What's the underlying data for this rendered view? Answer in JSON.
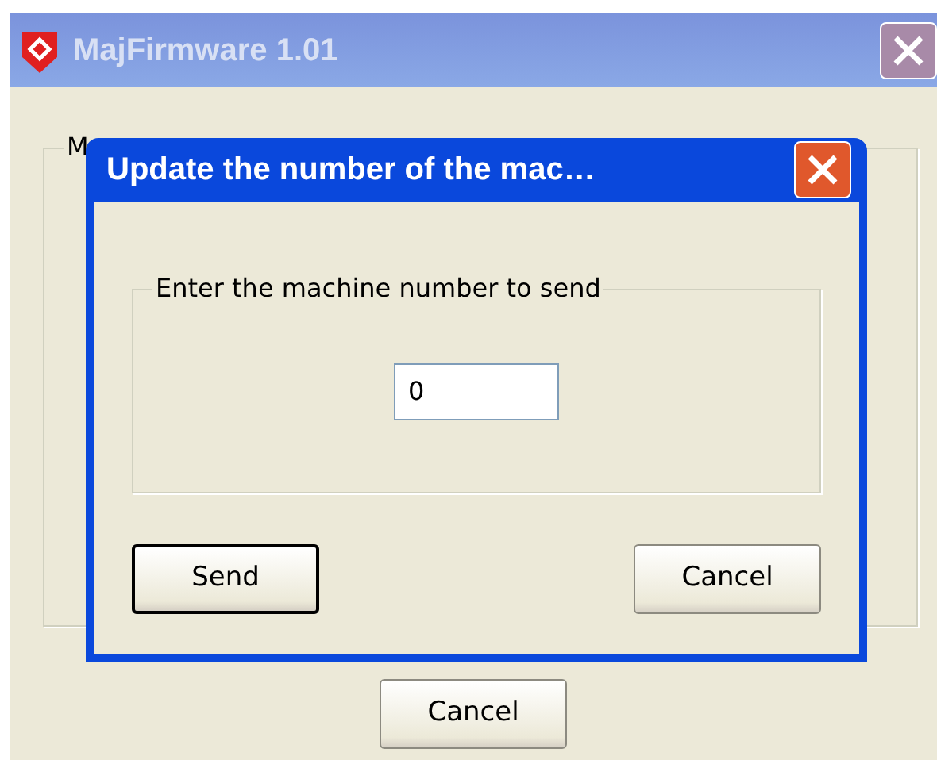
{
  "window": {
    "title": "MajFirmware 1.01",
    "group_label": "M",
    "buttons": [
      {
        "label": "Cancel",
        "default": false
      }
    ]
  },
  "dialog": {
    "title": "Update the number of the mac…",
    "group_label": "Enter the machine number to send",
    "field": {
      "value": "0"
    },
    "buttons": [
      {
        "label": "Send",
        "default": true
      },
      {
        "label": "Cancel",
        "default": false
      }
    ]
  }
}
